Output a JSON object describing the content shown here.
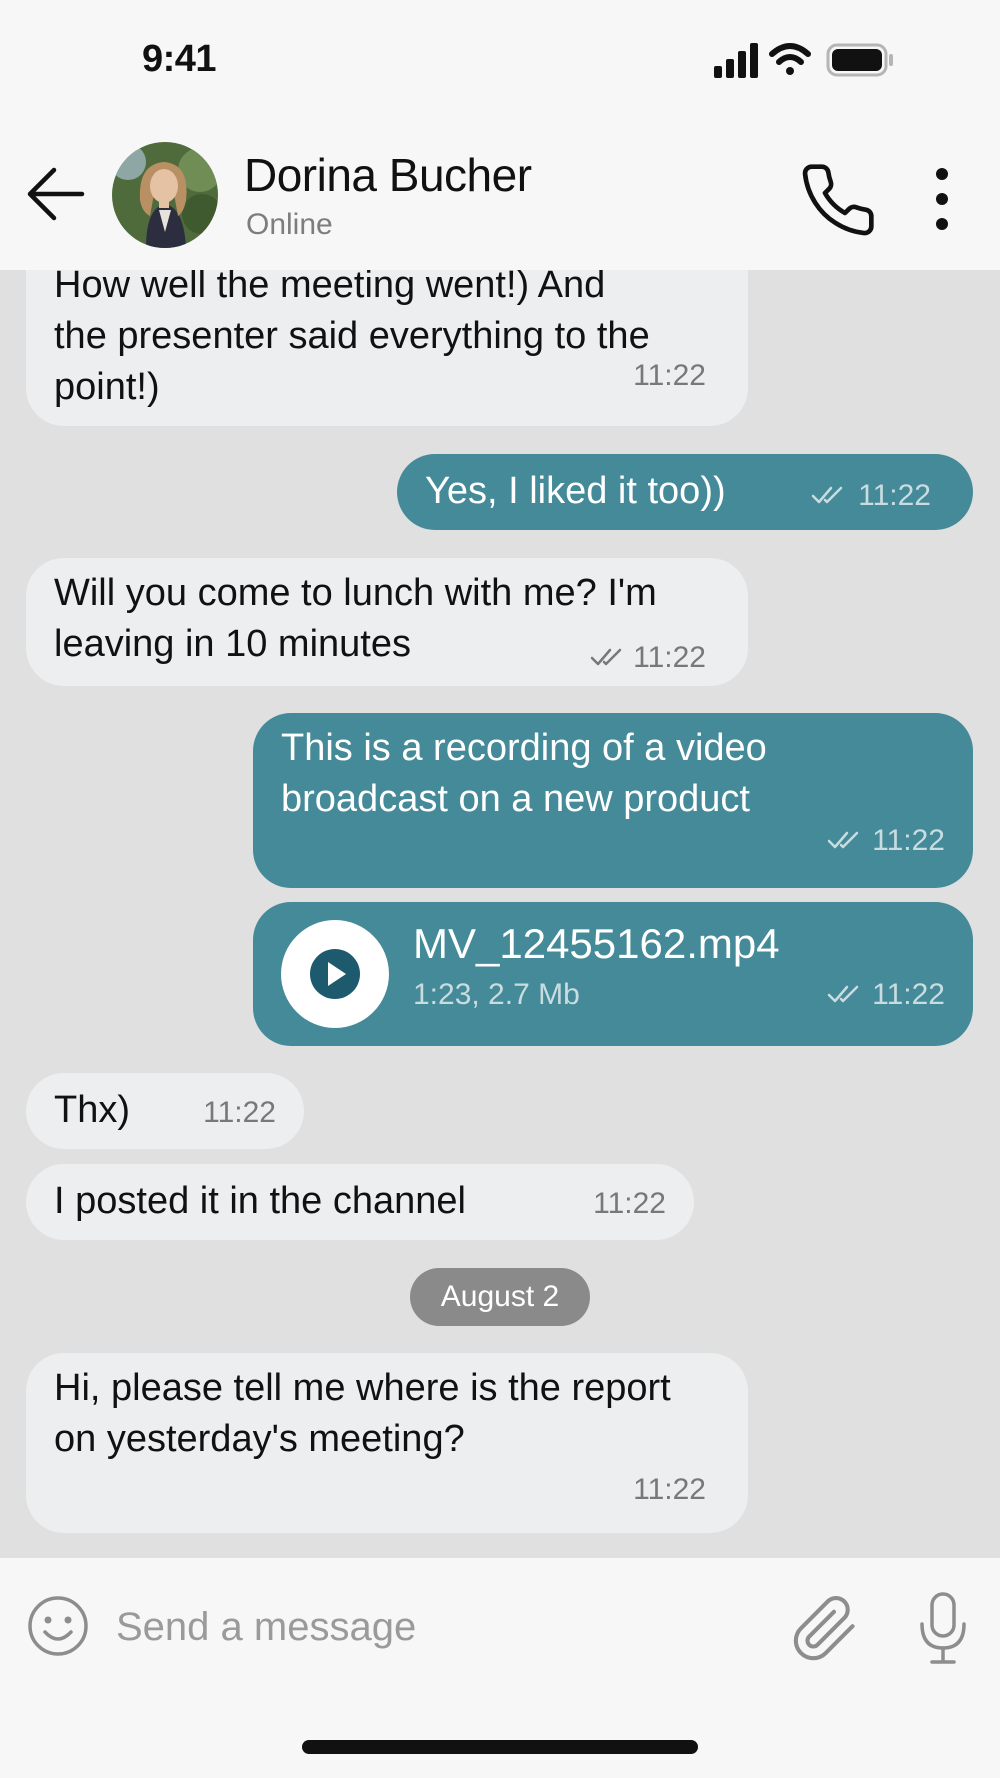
{
  "status_bar": {
    "time": "9:41"
  },
  "header": {
    "contact_name": "Dorina Bucher",
    "contact_status": "Online"
  },
  "messages": [
    {
      "direction": "incoming",
      "text": "How well the meeting went!) And\nthe presenter said everything to the\npoint!)",
      "time": "11:22"
    },
    {
      "direction": "outgoing",
      "text": "Yes, I liked it too))",
      "time": "11:22",
      "read": true
    },
    {
      "direction": "incoming",
      "text": "Will you come to lunch with me? I'm\nleaving in 10 minutes",
      "time": "11:22",
      "read": true
    },
    {
      "direction": "outgoing",
      "text": "This is a recording of a video\nbroadcast on a new product",
      "time": "11:22",
      "read": true
    },
    {
      "direction": "outgoing",
      "type": "file",
      "file_name": "MV_12455162.mp4",
      "file_info": "1:23, 2.7 Mb",
      "time": "11:22",
      "read": true
    },
    {
      "direction": "incoming",
      "text": "Thx)",
      "time": "11:22"
    },
    {
      "direction": "incoming",
      "text": "I posted it in the channel",
      "time": "11:22"
    },
    {
      "type": "date_separator",
      "text": "August 2"
    },
    {
      "direction": "incoming",
      "text": "Hi, please tell me where is the report\non yesterday's meeting?",
      "time": "11:22"
    }
  ],
  "composer": {
    "placeholder": "Send a message",
    "value": ""
  },
  "icons": {
    "back": "arrow-left-icon",
    "call": "phone-icon",
    "more": "more-vertical-icon",
    "emoji": "smile-icon",
    "attach": "paperclip-icon",
    "mic": "microphone-icon",
    "play": "play-icon",
    "read": "double-check-icon"
  },
  "colors": {
    "outgoing_bubble": "#448a98",
    "incoming_bubble": "#eceeef",
    "chat_background": "#e0e0e1",
    "date_pill": "#8a8a8a"
  }
}
